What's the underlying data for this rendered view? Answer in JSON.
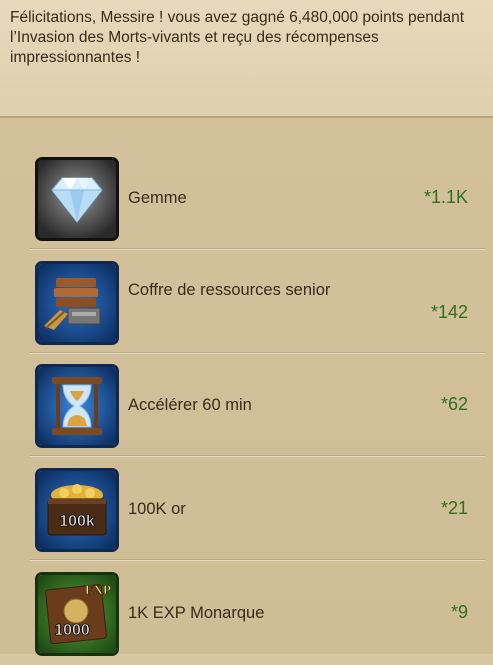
{
  "message": "Félicitations, Messire ! vous avez gagné 6,480,000 points pendant l’Invasion des Morts-vivants et reçu des récompenses impressionnantes !",
  "rewards": [
    {
      "name": "Gemme",
      "count": "*1.1K",
      "icon": "gem-icon"
    },
    {
      "name": "Coffre de ressources senior",
      "count": "*142",
      "icon": "resource-chest-icon"
    },
    {
      "name": "Accélérer 60 min",
      "count": "*62",
      "icon": "hourglass-icon"
    },
    {
      "name": "100K or",
      "count": "*21",
      "icon": "gold-chest-icon",
      "icon_text": "100k"
    },
    {
      "name": "1K EXP Monarque",
      "count": "*9",
      "icon": "exp-book-icon",
      "icon_text_top": "EXP",
      "icon_text_bottom": "1000"
    }
  ],
  "colors": {
    "background": "#d7c6a2",
    "text": "#3b2a17",
    "count": "#2f6f1e"
  }
}
